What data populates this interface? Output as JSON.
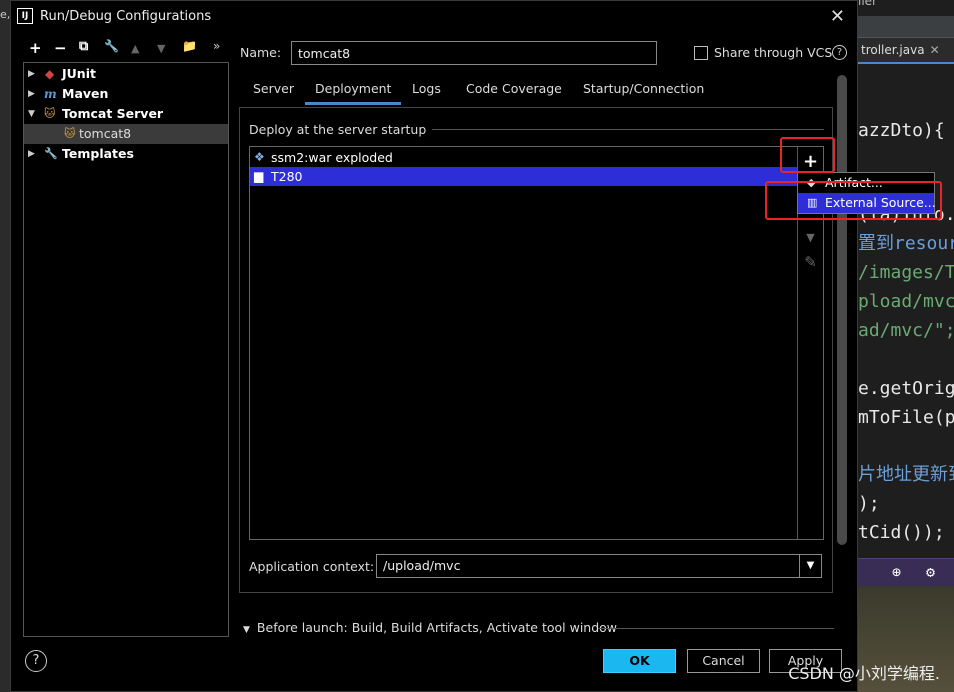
{
  "background": {
    "left_fragment": "e,",
    "top_fragment": "ller",
    "editor_tab": "troller.java",
    "editor_tab_close": "✕",
    "code_lines": [
      {
        "text": "azzDto){",
        "color": "#e8e8e8"
      },
      {
        "text": "(la)Info.",
        "color": "#e8e8e8"
      },
      {
        "text": "置到resour",
        "color": "#6a9fd8"
      },
      {
        "text": "/images/T",
        "color": "#6aab73"
      },
      {
        "text": "pload/mvc",
        "color": "#6aab73"
      },
      {
        "text": "ad/mvc/\";",
        "color": "#6aab73"
      },
      {
        "text": "e.getOrig",
        "color": "#e8e8e8"
      },
      {
        "text": "mToFile(p",
        "color": "#e8e8e8"
      },
      {
        "text": "片地址更新到",
        "color": "#6a9fd8"
      },
      {
        "text": ");",
        "color": "#e8e8e8"
      },
      {
        "text": "tCid());",
        "color": "#e8e8e8"
      }
    ],
    "watermark": "CSDN @小刘学编程."
  },
  "dialog": {
    "title": "Run/Debug Configurations",
    "title_icon": "IJ",
    "close_glyph": "✕",
    "toolbar": {
      "add": "+",
      "remove": "−",
      "copy": "⧉",
      "edit": "🔧",
      "up": "▲",
      "down": "▼",
      "folder": "📁",
      "more": "»"
    },
    "tree": [
      {
        "label": "JUnit",
        "icon": "junit-icon",
        "glyph": "◆",
        "color": "#d14545",
        "arrow": "▶",
        "depth": 0
      },
      {
        "label": "Maven",
        "icon": "maven-icon",
        "glyph": "m",
        "color": "#5b9bd5",
        "arrow": "▶",
        "depth": 0
      },
      {
        "label": "Tomcat Server",
        "icon": "tomcat-icon",
        "glyph": "🐱",
        "color": "#d8a040",
        "arrow": "▼",
        "depth": 0
      },
      {
        "label": "tomcat8",
        "icon": "tomcat-icon",
        "glyph": "🐱",
        "color": "#d8a040",
        "arrow": "",
        "depth": 1,
        "selected": true
      },
      {
        "label": "Templates",
        "icon": "wrench-icon",
        "glyph": "🔧",
        "color": "#dddddd",
        "arrow": "▶",
        "depth": 0
      }
    ],
    "name_label": "Name:",
    "name_value": "tomcat8",
    "share_label": "Share through VCS",
    "help_glyph": "?",
    "tabs": [
      "Server",
      "Deployment",
      "Logs",
      "Code Coverage",
      "Startup/Connection"
    ],
    "active_tab": "Deployment",
    "deploy_legend": "Deploy at the server startup",
    "artifacts": [
      {
        "label": "ssm2:war exploded",
        "icon": "artifact-icon"
      },
      {
        "label": "T280",
        "icon": "folder-icon",
        "selected": true
      }
    ],
    "list_tools": {
      "add": "+",
      "down": "▼",
      "edit": "✎"
    },
    "app_context_label": "Application context:",
    "app_context_value": "/upload/mvc",
    "before_launch": "Before launch: Build, Build Artifacts, Activate tool window",
    "buttons": {
      "ok": "OK",
      "cancel": "Cancel",
      "apply": "Apply"
    },
    "popup": [
      {
        "label": "Artifact...",
        "icon": "artifact-icon"
      },
      {
        "label": "External Source...",
        "icon": "external-source-icon",
        "highlighted": true
      }
    ]
  },
  "colors": {
    "accent_blue": "#1ab7f0",
    "selection": "#2e2ed9",
    "highlight_red": "#e8242a"
  }
}
